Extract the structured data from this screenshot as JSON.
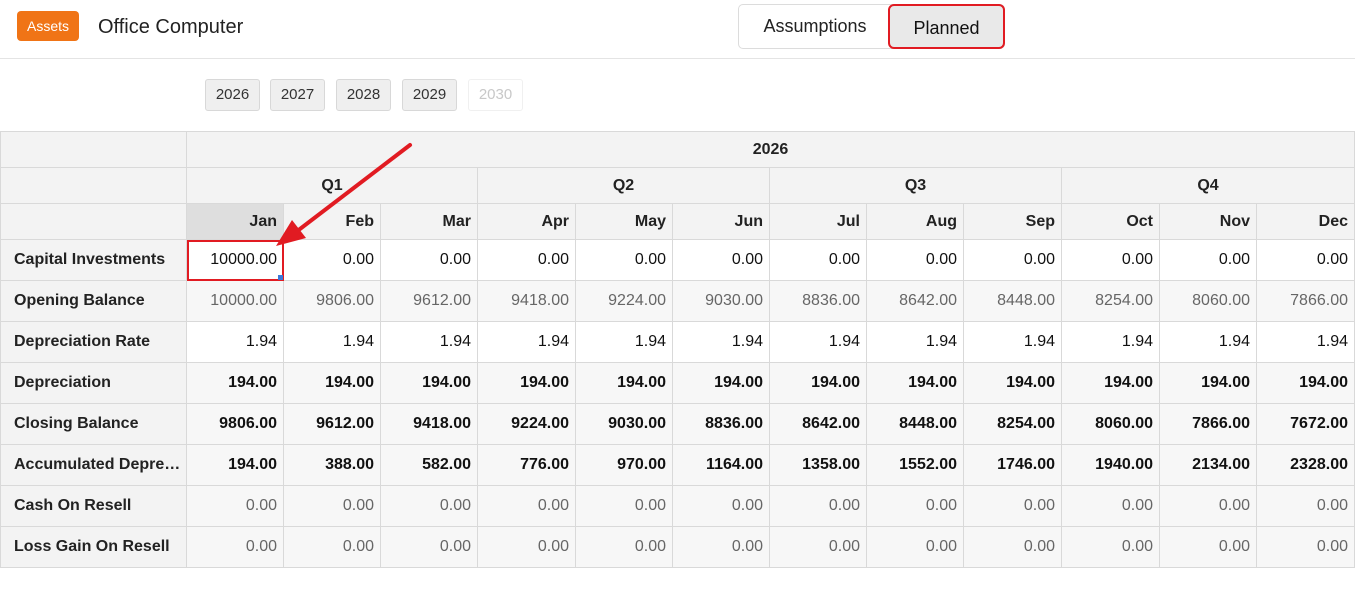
{
  "header": {
    "badge": "Assets",
    "title": "Office Computer",
    "toggle": {
      "assumptions": "Assumptions",
      "planned": "Planned"
    }
  },
  "years": [
    "2026",
    "2027",
    "2028",
    "2029",
    "2030"
  ],
  "grid": {
    "year": "2026",
    "quarters": [
      "Q1",
      "Q2",
      "Q3",
      "Q4"
    ],
    "months": [
      "Jan",
      "Feb",
      "Mar",
      "Apr",
      "May",
      "Jun",
      "Jul",
      "Aug",
      "Sep",
      "Oct",
      "Nov",
      "Dec"
    ],
    "rows": [
      {
        "label": "Capital Investments",
        "values": [
          "10000.00",
          "0.00",
          "0.00",
          "0.00",
          "0.00",
          "0.00",
          "0.00",
          "0.00",
          "0.00",
          "0.00",
          "0.00",
          "0.00"
        ]
      },
      {
        "label": "Opening Balance",
        "values": [
          "10000.00",
          "9806.00",
          "9612.00",
          "9418.00",
          "9224.00",
          "9030.00",
          "8836.00",
          "8642.00",
          "8448.00",
          "8254.00",
          "8060.00",
          "7866.00"
        ]
      },
      {
        "label": "Depreciation Rate",
        "values": [
          "1.94",
          "1.94",
          "1.94",
          "1.94",
          "1.94",
          "1.94",
          "1.94",
          "1.94",
          "1.94",
          "1.94",
          "1.94",
          "1.94"
        ]
      },
      {
        "label": "Depreciation",
        "values": [
          "194.00",
          "194.00",
          "194.00",
          "194.00",
          "194.00",
          "194.00",
          "194.00",
          "194.00",
          "194.00",
          "194.00",
          "194.00",
          "194.00"
        ]
      },
      {
        "label": "Closing Balance",
        "values": [
          "9806.00",
          "9612.00",
          "9418.00",
          "9224.00",
          "9030.00",
          "8836.00",
          "8642.00",
          "8448.00",
          "8254.00",
          "8060.00",
          "7866.00",
          "7672.00"
        ]
      },
      {
        "label": "Accumulated Depre…",
        "values": [
          "194.00",
          "388.00",
          "582.00",
          "776.00",
          "970.00",
          "1164.00",
          "1358.00",
          "1552.00",
          "1746.00",
          "1940.00",
          "2134.00",
          "2328.00"
        ]
      },
      {
        "label": "Cash On Resell",
        "values": [
          "0.00",
          "0.00",
          "0.00",
          "0.00",
          "0.00",
          "0.00",
          "0.00",
          "0.00",
          "0.00",
          "0.00",
          "0.00",
          "0.00"
        ]
      },
      {
        "label": "Loss Gain On Resell",
        "values": [
          "0.00",
          "0.00",
          "0.00",
          "0.00",
          "0.00",
          "0.00",
          "0.00",
          "0.00",
          "0.00",
          "0.00",
          "0.00",
          "0.00"
        ]
      }
    ]
  },
  "colors": {
    "badge": "#f07416",
    "highlight": "#e11b22",
    "arrow": "#e11b22"
  }
}
